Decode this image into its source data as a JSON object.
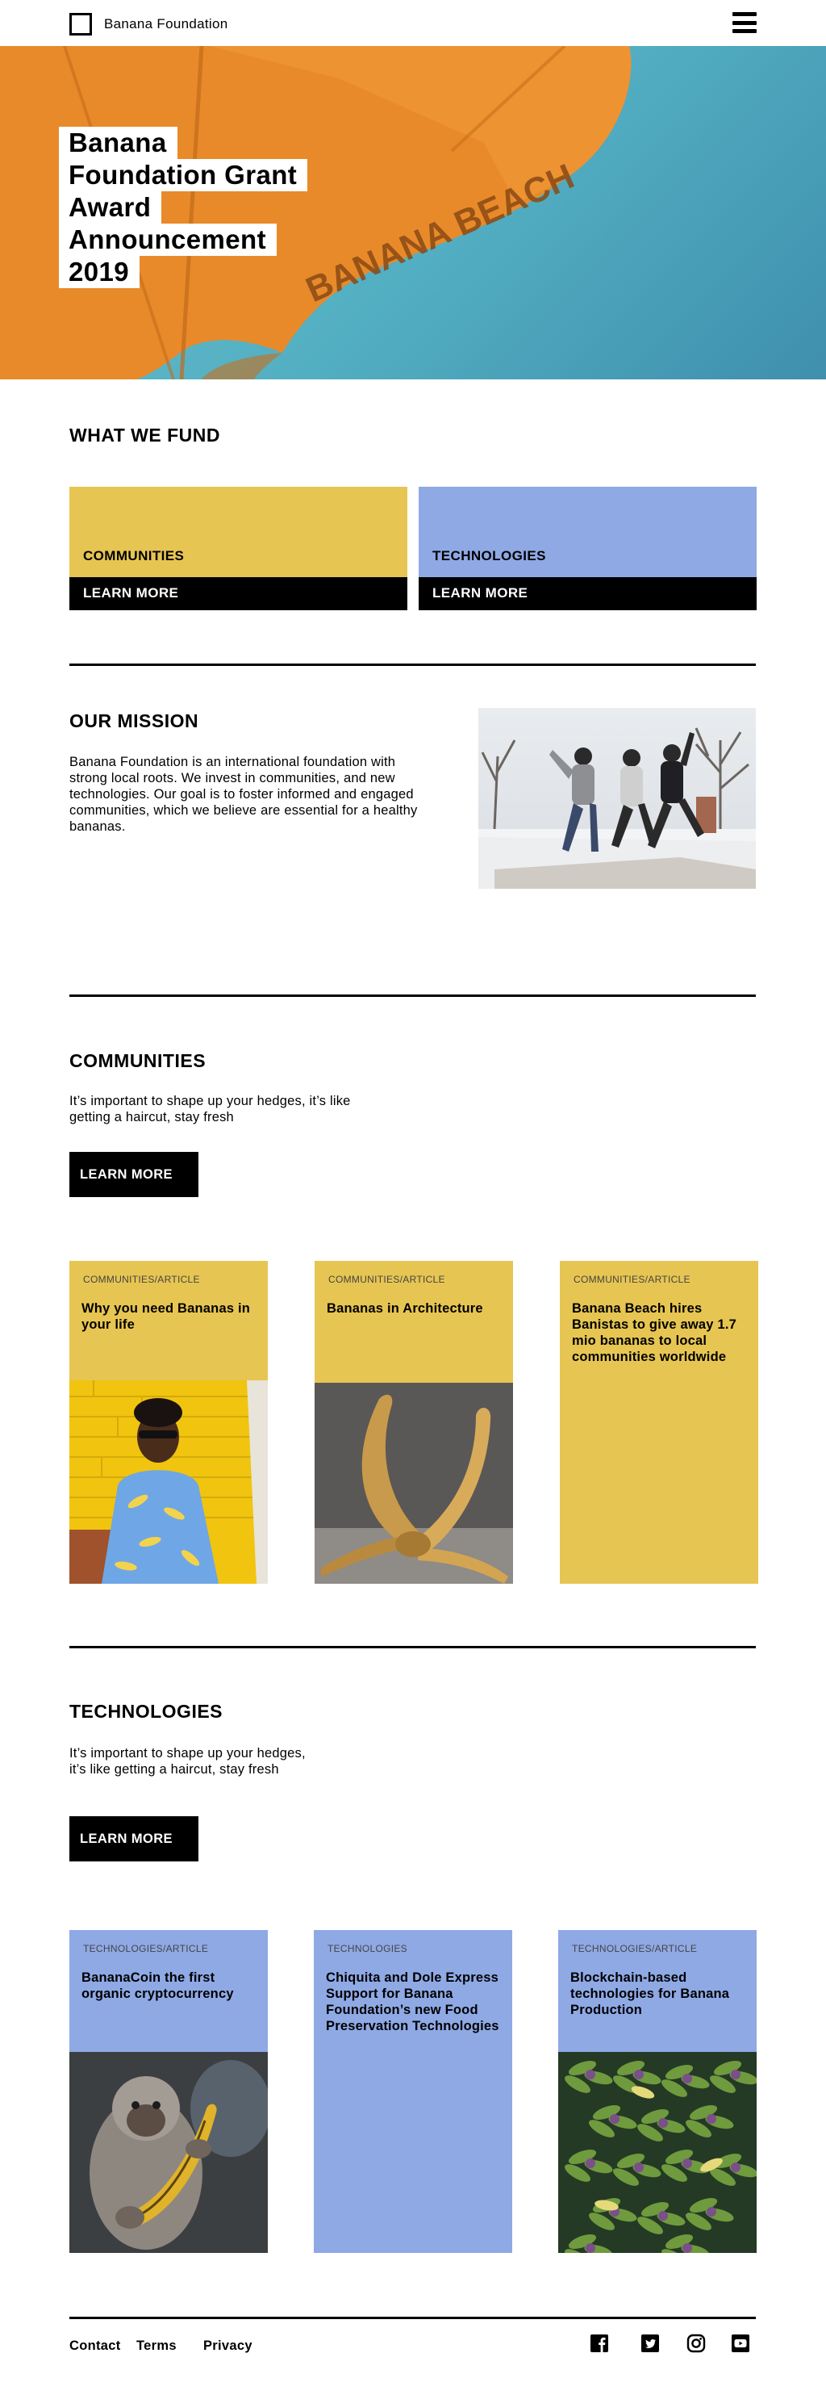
{
  "header": {
    "logo_text": "Banana Foundation"
  },
  "hero": {
    "title_lines": [
      "Banana",
      "Foundation Grant",
      "Award",
      "Announcement",
      "2019"
    ],
    "umbrella_text": "BANANA BEACH"
  },
  "fund": {
    "heading": "WHAT WE FUND",
    "cards": [
      {
        "label": "COMMUNITIES",
        "more": "LEARN MORE",
        "color": "#e7c552"
      },
      {
        "label": "TECHNOLOGIES",
        "more": "LEARN MORE",
        "color": "#8fa9e5"
      }
    ]
  },
  "mission": {
    "heading": "OUR MISSION",
    "text": "Banana Foundation is an international foundation with strong local roots. We invest in communities, and new technologies. Our goal is to foster informed and engaged communities, which we believe are essential for a healthy bananas."
  },
  "communities": {
    "heading": "COMMUNITIES",
    "intro_lines": [
      "It’s important to shape up your hedges, it’s like",
      "getting a haircut, stay fresh"
    ],
    "cta": "LEARN MORE",
    "cards": [
      {
        "tag": "COMMUNITIES/ARTICLE",
        "title": "Why you need Bananas in your life"
      },
      {
        "tag": "COMMUNITIES/ARTICLE",
        "title": "Bananas in Architecture"
      },
      {
        "tag": "COMMUNITIES/ARTICLE",
        "title": "Banana Beach hires Banistas to give away 1.7 mio bananas to local communities worldwide"
      }
    ]
  },
  "technologies": {
    "heading": "TECHNOLOGIES",
    "intro_lines": [
      "It’s important to shape up your hedges,",
      "it’s like getting a haircut, stay fresh"
    ],
    "cta": "LEARN MORE",
    "cards": [
      {
        "tag": "TECHNOLOGIES/ARTICLE",
        "title": "BananaCoin the first organic cryptocurrency"
      },
      {
        "tag": "TECHNOLOGIES",
        "title": "Chiquita and Dole Express Support for Banana Foundation’s new Food Preservation Technologies"
      },
      {
        "tag": "TECHNOLOGIES/ARTICLE",
        "title": "Blockchain-based technologies for Banana Production"
      }
    ]
  },
  "footer": {
    "links": [
      "Contact",
      "Terms",
      "Privacy"
    ],
    "social_icons": [
      "facebook-icon",
      "twitter-icon",
      "instagram-icon",
      "youtube-icon"
    ]
  },
  "colors": {
    "yellow": "#e7c552",
    "blue": "#8fa9e5",
    "umbrella_orange": "#e98a2a",
    "sky": "#5fb8c9"
  }
}
